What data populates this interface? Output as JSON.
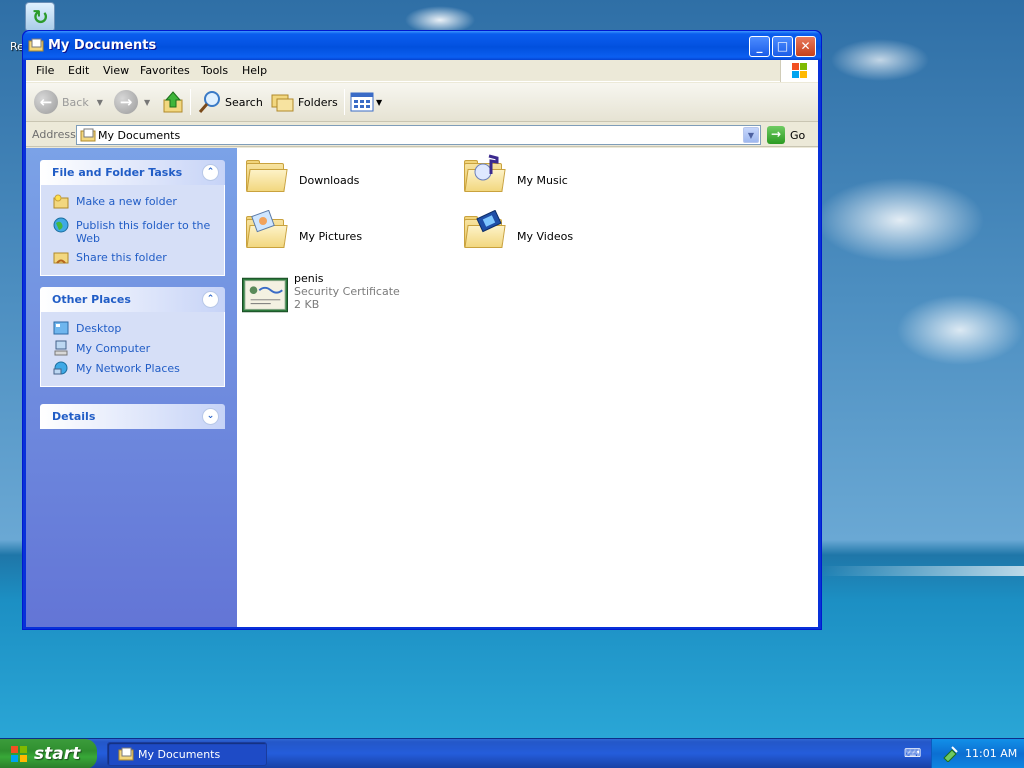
{
  "desktop": {
    "icons": [
      {
        "label": "Re"
      }
    ]
  },
  "window": {
    "title": "My Documents",
    "buttons": {
      "minimize": "_",
      "maximize": "□",
      "close": "✕"
    }
  },
  "menu": {
    "items": [
      "File",
      "Edit",
      "View",
      "Favorites",
      "Tools",
      "Help"
    ]
  },
  "toolbar": {
    "back_label": "Back",
    "search_label": "Search",
    "folders_label": "Folders"
  },
  "address": {
    "label": "Address",
    "value": "My Documents",
    "go_label": "Go"
  },
  "taskpane": {
    "file_tasks": {
      "title": "File and Folder Tasks",
      "items": [
        "Make a new folder",
        "Publish this folder to the Web",
        "Share this folder"
      ]
    },
    "other_places": {
      "title": "Other Places",
      "items": [
        "Desktop",
        "My Computer",
        "My Network Places"
      ]
    },
    "details": {
      "title": "Details"
    }
  },
  "files": [
    {
      "name": "Downloads",
      "kind": "folder"
    },
    {
      "name": "My Music",
      "kind": "folder"
    },
    {
      "name": "My Pictures",
      "kind": "folder"
    },
    {
      "name": "My Videos",
      "kind": "folder"
    },
    {
      "name": "penis",
      "type": "Security Certificate",
      "size": "2 KB",
      "kind": "certificate"
    }
  ],
  "taskbar": {
    "start_label": "start",
    "window_button": "My Documents",
    "clock": "11:01 AM"
  },
  "colors": {
    "title_blue": "#0554e3",
    "link_blue": "#215dc6",
    "start_green": "#38a838"
  }
}
